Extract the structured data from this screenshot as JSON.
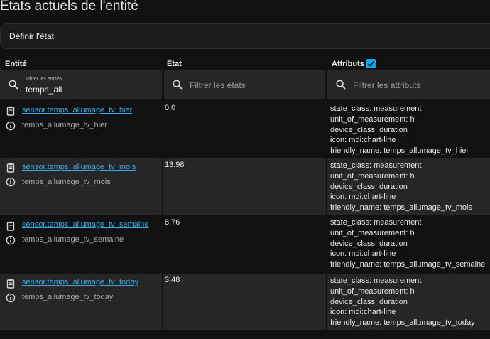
{
  "page": {
    "title": "États actuels de l'entité"
  },
  "set_state": {
    "label": "Définir l'état"
  },
  "columns": {
    "entity": "Entité",
    "state": "État",
    "attributes": "Attributs",
    "attributes_checked": true
  },
  "filters": {
    "entity": {
      "label": "Filtrer les entités",
      "value": "temps_all"
    },
    "state": {
      "placeholder": "Filtrer les états"
    },
    "attributes": {
      "placeholder": "Filtrer les attributs"
    }
  },
  "icons": {
    "copy": "clipboard-icon",
    "info": "info-circle-icon",
    "search": "magnify-icon",
    "check": "checkbox-check-icon"
  },
  "colors": {
    "accent": "#03a9f4",
    "link": "#36a9e6",
    "row_alt": "#262626",
    "background": "#111111"
  },
  "rows": [
    {
      "entity_id": "sensor.temps_allumage_tv_hier",
      "name": "temps_allumage_tv_hier",
      "state": "0.0",
      "attributes": [
        "state_class: measurement",
        "unit_of_measurement: h",
        "device_class: duration",
        "icon: mdi:chart-line",
        "friendly_name: temps_allumage_tv_hier"
      ]
    },
    {
      "entity_id": "sensor.temps_allumage_tv_mois",
      "name": "temps_allumage_tv_mois",
      "state": "13.98",
      "attributes": [
        "state_class: measurement",
        "unit_of_measurement: h",
        "device_class: duration",
        "icon: mdi:chart-line",
        "friendly_name: temps_allumage_tv_mois"
      ]
    },
    {
      "entity_id": "sensor.temps_allumage_tv_semaine",
      "name": "temps_allumage_tv_semaine",
      "state": "8.76",
      "attributes": [
        "state_class: measurement",
        "unit_of_measurement: h",
        "device_class: duration",
        "icon: mdi:chart-line",
        "friendly_name: temps_allumage_tv_semaine"
      ]
    },
    {
      "entity_id": "sensor.temps_allumage_tv_today",
      "name": "temps_allumage_tv_today",
      "state": "3.48",
      "attributes": [
        "state_class: measurement",
        "unit_of_measurement: h",
        "device_class: duration",
        "icon: mdi:chart-line",
        "friendly_name: temps_allumage_tv_today"
      ]
    }
  ]
}
